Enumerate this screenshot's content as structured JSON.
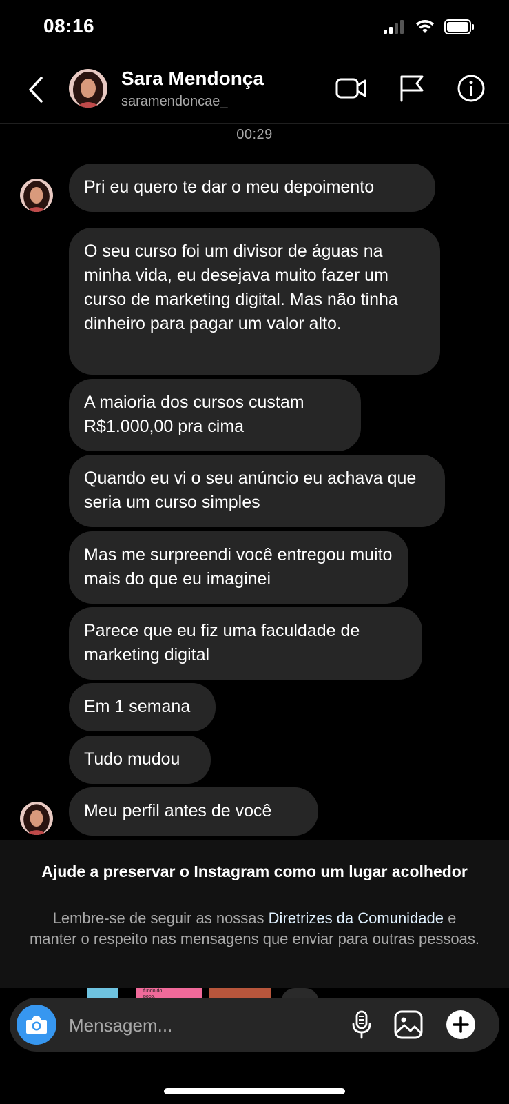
{
  "status_bar": {
    "time": "08:16"
  },
  "header": {
    "name": "Sara Mendonça",
    "username": "saramendoncae_"
  },
  "thread": {
    "timestamp": "00:29",
    "messages": [
      "Pri eu quero te dar o meu depoimento",
      "O seu curso foi um divisor de águas na minha vida, eu desejava muito fazer um curso de marketing digital. Mas não tinha dinheiro para pagar um valor alto.",
      "A maioria dos cursos custam R$1.000,00 pra cima",
      "Quando eu vi o seu anúncio eu achava que seria um curso simples",
      "Mas me surpreendi você entregou muito mais do que eu imaginei",
      "Parece que eu fiz uma faculdade de marketing digital",
      "Em 1 semana",
      "Tudo mudou",
      "Meu perfil antes de você"
    ]
  },
  "notice": {
    "title": "Ajude a preservar o Instagram como um lugar acolhedor",
    "body_before": "Lembre-se de seguir as nossas ",
    "link": "Diretrizes da Comunidade",
    "body_after": " e manter o respeito nas mensagens que enviar para outras pessoas."
  },
  "thumbnail_caption": "fundo do poço.",
  "composer": {
    "placeholder": "Mensagem..."
  },
  "colors": {
    "background": "#000000",
    "bubble": "#262626",
    "accent": "#3797f0",
    "secondary_text": "#a8a8a8"
  },
  "icons": [
    "back-icon",
    "video-call-icon",
    "flag-icon",
    "info-icon",
    "camera-icon",
    "microphone-icon",
    "gallery-icon",
    "plus-icon",
    "signal-icon",
    "wifi-icon",
    "battery-icon"
  ]
}
